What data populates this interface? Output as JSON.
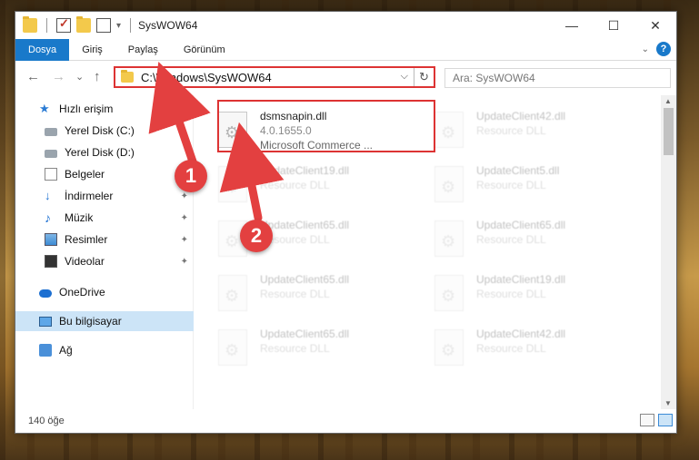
{
  "title": "SysWOW64",
  "window_controls": {
    "minimize": "—",
    "maximize": "☐",
    "close": "✕"
  },
  "ribbon": {
    "tabs": [
      {
        "label": "Dosya",
        "active": true
      },
      {
        "label": "Giriş"
      },
      {
        "label": "Paylaş"
      },
      {
        "label": "Görünüm"
      }
    ],
    "help": "?"
  },
  "address": {
    "path": "C:\\Windows\\SysWOW64",
    "refresh": "↻",
    "dropdown": "⌵"
  },
  "search": {
    "placeholder": "Ara: SysWOW64"
  },
  "nav": {
    "back": "←",
    "forward": "→",
    "recent": "⌄",
    "up": "↑",
    "items": [
      {
        "label": "Hızlı erişim",
        "icon": "star-icon"
      },
      {
        "label": "Yerel Disk (C:)",
        "icon": "drive-icon"
      },
      {
        "label": "Yerel Disk (D:)",
        "icon": "drive-icon"
      },
      {
        "label": "Belgeler",
        "icon": "documents-icon"
      },
      {
        "label": "İndirmeler",
        "icon": "download-icon"
      },
      {
        "label": "Müzik",
        "icon": "music-icon"
      },
      {
        "label": "Resimler",
        "icon": "pictures-icon"
      },
      {
        "label": "Videolar",
        "icon": "videos-icon"
      },
      {
        "label": "OneDrive",
        "icon": "cloud-icon"
      },
      {
        "label": "Bu bilgisayar",
        "icon": "computer-icon",
        "selected": true
      },
      {
        "label": "Ağ",
        "icon": "network-icon"
      }
    ],
    "pin": "📌"
  },
  "files": [
    {
      "name": "dsmsnapin.dll",
      "version": "4.0.1655.0",
      "company": "Microsoft Commerce ...",
      "highlighted": true
    },
    {
      "name": "UpdateClient42.dll",
      "type": "Resource DLL"
    },
    {
      "name": "UpdateClient19.dll",
      "type": "Resource DLL"
    },
    {
      "name": "UpdateClient5.dll",
      "type": "Resource DLL"
    },
    {
      "name": "UpdateClient65.dll",
      "type": "Resource DLL"
    },
    {
      "name": "UpdateClient65.dll",
      "type": "Resource DLL"
    },
    {
      "name": "UpdateClient65.dll",
      "type": "Resource DLL"
    },
    {
      "name": "UpdateClient19.dll",
      "type": "Resource DLL"
    },
    {
      "name": "UpdateClient65.dll",
      "type": "Resource DLL"
    },
    {
      "name": "UpdateClient42.dll",
      "type": "Resource DLL"
    }
  ],
  "status": {
    "count": "140 öğe"
  },
  "annotations": {
    "step1": "1",
    "step2": "2"
  },
  "colors": {
    "accent": "#1979ca",
    "highlight": "#dd3333",
    "selection": "#cce4f7"
  }
}
